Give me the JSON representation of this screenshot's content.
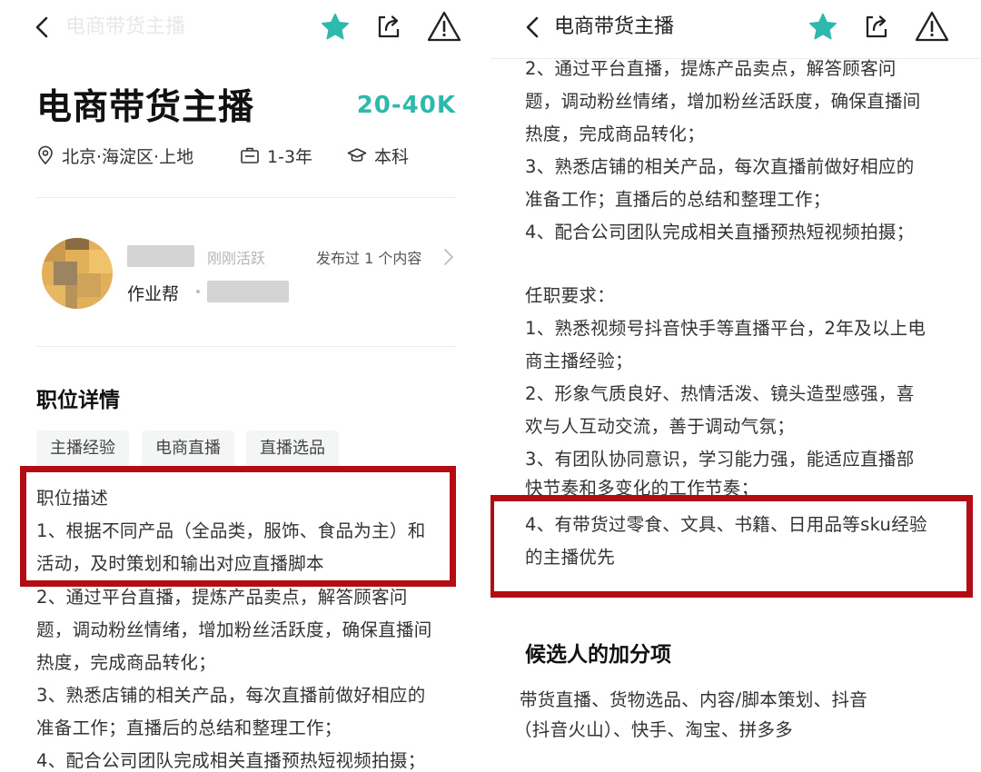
{
  "left": {
    "nav_title": "电商带货主播",
    "job_title": "电商带货主播",
    "salary": "20-40K",
    "location": "北京·海淀区·上地",
    "experience": "1-3年",
    "education": "本科",
    "recruiter": {
      "active_status": "刚刚活跃",
      "posted_count": "发布过 1 个内容",
      "company": "作业帮"
    },
    "section_title": "职位详情",
    "tags": [
      "主播经验",
      "电商直播",
      "直播选品"
    ],
    "description_lines": [
      "职位描述",
      "1、根据不同产品（全品类，服饰、食品为主）和",
      "活动，及时策划和输出对应直播脚本",
      "2、通过平台直播，提炼产品卖点，解答顾客问",
      "题，调动粉丝情绪，增加粉丝活跃度，确保直播间",
      "热度，完成商品转化；",
      "3、熟悉店铺的相关产品，每次直播前做好相应的",
      "准备工作；直播后的总结和整理工作；",
      "4、配合公司团队完成相关直播预热短视频拍摄；"
    ]
  },
  "right": {
    "nav_title": "电商带货主播",
    "description_lines": [
      "2、通过平台直播，提炼产品卖点，解答顾客问",
      "题，调动粉丝情绪，增加粉丝活跃度，确保直播间",
      "热度，完成商品转化；",
      "3、熟悉店铺的相关产品，每次直播前做好相应的",
      "准备工作；直播后的总结和整理工作；",
      "4、配合公司团队完成相关直播预热短视频拍摄；"
    ],
    "requirements_lines": [
      "任职要求：",
      "1、熟悉视频号抖音快手等直播平台，2年及以上电",
      "商主播经验；",
      "2、形象气质良好、热情活泼、镜头造型感强，喜",
      "欢与人互动交流，善于调动气氛；",
      "3、有团队协同意识，学习能力强，能适应直播部",
      "快节奏和多变化的工作节奏；",
      "4、有带货过零食、文具、书籍、日用品等sku经验",
      "的主播优先"
    ],
    "bonus_title": "候选人的加分项",
    "bonus_lines": [
      "带货直播、货物选品、内容/脚本策划、抖音",
      "（抖音火山）、快手、淘宝、拼多多"
    ]
  },
  "colors": {
    "accent": "#2fb8ac",
    "highlight_box": "#b30d13"
  },
  "icons": {
    "back": "chevron-left-icon",
    "favorite": "star-icon",
    "share": "share-icon",
    "report": "warning-icon",
    "location": "location-pin-icon",
    "experience": "briefcase-icon",
    "education": "graduation-cap-icon",
    "more": "chevron-right-icon"
  }
}
